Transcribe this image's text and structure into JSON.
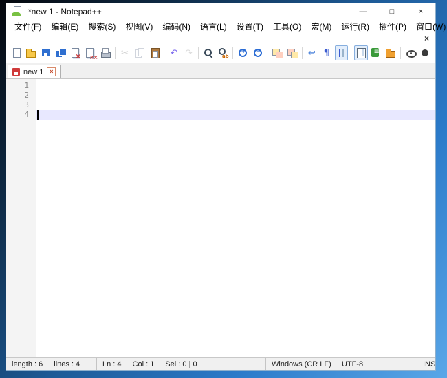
{
  "window": {
    "title": "*new 1 - Notepad++",
    "controls": [
      {
        "name": "minimize-button",
        "glyph": "—"
      },
      {
        "name": "maximize-button",
        "glyph": "□"
      },
      {
        "name": "close-button",
        "glyph": "×"
      }
    ]
  },
  "menu": {
    "items": [
      "文件(F)",
      "编辑(E)",
      "搜索(S)",
      "视图(V)",
      "编码(N)",
      "语言(L)",
      "设置(T)",
      "工具(O)",
      "宏(M)",
      "运行(R)",
      "插件(P)",
      "窗口(W)",
      "?"
    ],
    "close_glyph": "×"
  },
  "toolbar": {
    "items": [
      {
        "name": "new-file",
        "type": "page"
      },
      {
        "name": "open-file",
        "type": "folder"
      },
      {
        "name": "save-file",
        "type": "floppy"
      },
      {
        "name": "save-all",
        "type": "floppy2"
      },
      {
        "name": "close-file",
        "type": "page-x"
      },
      {
        "name": "close-all-files",
        "type": "page-xx"
      },
      {
        "name": "print",
        "type": "printer"
      },
      {
        "type": "sep"
      },
      {
        "name": "cut",
        "type": "glyph",
        "glyph": "✂",
        "color": "#9a9a9a",
        "disabled": true
      },
      {
        "name": "copy",
        "type": "copy",
        "disabled": true
      },
      {
        "name": "paste",
        "type": "paste"
      },
      {
        "type": "sep"
      },
      {
        "name": "undo",
        "type": "glyph",
        "glyph": "↶",
        "color": "#7b68ee"
      },
      {
        "name": "redo",
        "type": "glyph",
        "glyph": "↷",
        "color": "#b0b0b0",
        "disabled": true
      },
      {
        "type": "sep"
      },
      {
        "name": "find",
        "type": "find"
      },
      {
        "name": "replace",
        "type": "replace"
      },
      {
        "type": "sep"
      },
      {
        "name": "zoom-in",
        "type": "zoom-in"
      },
      {
        "name": "zoom-out",
        "type": "zoom-out"
      },
      {
        "type": "sep"
      },
      {
        "name": "sync-vertical-scrolling",
        "type": "win2"
      },
      {
        "name": "sync-horizontal-scrolling",
        "type": "win2b"
      },
      {
        "type": "sep"
      },
      {
        "name": "word-wrap",
        "type": "glyph",
        "glyph": "↩",
        "color": "#2b6cd4"
      },
      {
        "name": "show-all-characters",
        "type": "glyph",
        "glyph": "¶",
        "color": "#3b5bd0"
      },
      {
        "name": "indent-guide",
        "type": "guide",
        "pressed": true
      },
      {
        "type": "sep"
      },
      {
        "name": "document-map",
        "type": "map",
        "pressed": true
      },
      {
        "name": "function-list",
        "type": "funclist"
      },
      {
        "name": "folder-as-workspace",
        "type": "folderw"
      },
      {
        "type": "sep"
      },
      {
        "name": "monitoring",
        "type": "eye"
      },
      {
        "name": "macro-record",
        "type": "rec"
      }
    ]
  },
  "tabs": [
    {
      "label": "new 1",
      "unsaved": true,
      "close_glyph": "×"
    }
  ],
  "editor": {
    "line_numbers": [
      "1",
      "2",
      "3",
      "4"
    ],
    "current_line": 4
  },
  "status": {
    "sections": [
      {
        "name": "doc-stats",
        "parts": [
          "length : 6",
          "lines : 4"
        ]
      },
      {
        "name": "cursor-position",
        "parts": [
          "Ln : 4",
          "Col : 1",
          "Sel : 0 | 0"
        ]
      },
      {
        "name": "eol-format",
        "parts": [
          "Windows (CR LF)"
        ]
      },
      {
        "name": "encoding",
        "parts": [
          "UTF-8"
        ]
      },
      {
        "name": "insert-mode",
        "parts": [
          "INS"
        ]
      }
    ]
  },
  "colors": {
    "accent": "#2b7ac9",
    "current_line_highlight": "#e8e8ff",
    "unsaved_indicator": "#cf3a3a"
  }
}
